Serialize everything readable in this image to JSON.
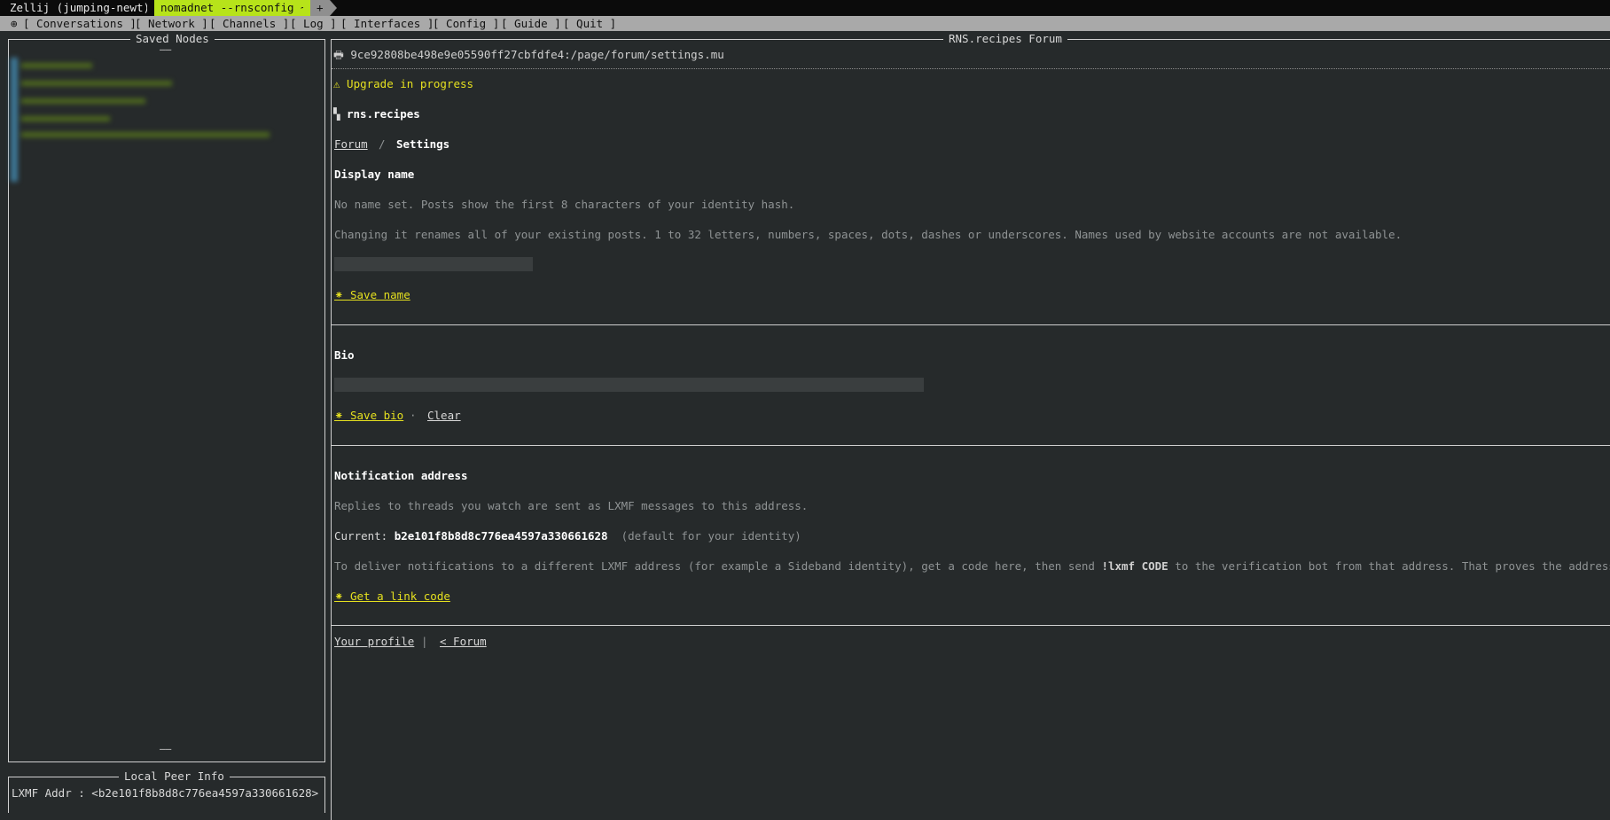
{
  "zellij": {
    "session_label": "Zellij (jumping-newt)",
    "active_tab": "nomadnet --rnsconfig ~",
    "new_tab": "+"
  },
  "menu": {
    "icon": "⊕",
    "items": [
      "[ Conversations ]",
      "[ Network ]",
      "[ Channels ]",
      "[ Log ]",
      "[ Interfaces ]",
      "[ Config ]",
      "[ Guide ]",
      "[ Quit ]"
    ]
  },
  "sidebar": {
    "saved_nodes_title": "Saved Nodes",
    "top_mark": "——",
    "bottom_mark": "——",
    "local_peer_title": "Local Peer Info",
    "lxmf_addr": "LXMF Addr : <b2e101f8b8d8c776ea4597a330661628>"
  },
  "browser": {
    "title": "RNS.recipes Forum",
    "url": "🖶 9ce92808be498e9e05590ff27cbfdfe4:/page/forum/settings.mu",
    "upgrade_notice": "⚠ Upgrade in progress",
    "site_icon": "▚",
    "site_name": "rns.recipes",
    "breadcrumb": {
      "forum": "Forum",
      "sep": "/",
      "current": "Settings"
    },
    "display_name": {
      "heading": "Display name",
      "desc": "No name set. Posts show the first 8 characters of your identity hash.",
      "help": "Changing it renames all of your existing posts. 1 to 32 letters, numbers, spaces, dots, dashes or underscores. Names used by website accounts are not available.",
      "input_value": "",
      "save_label": "⁕ Save name"
    },
    "bio": {
      "heading": "Bio",
      "input_value": "",
      "save_label": "⁕ Save bio",
      "sep": "·",
      "clear_label": "Clear"
    },
    "notification": {
      "heading": "Notification address",
      "desc": "Replies to threads you watch are sent as LXMF messages to this address.",
      "current_label": "Current: ",
      "current_value": "b2e101f8b8d8c776ea4597a330661628",
      "current_note": "(default for your identity)",
      "deliver_pre": "To deliver notifications to a different LXMF address (for example a Sideband identity), get a code here, then send ",
      "deliver_cmd": "!lxmf CODE",
      "deliver_post": " to the verification bot from that address. That proves the address is yours.",
      "link_code_label": "⁕ Get a link code"
    },
    "footer": {
      "profile": "Your profile",
      "sep": "|",
      "back": "< Forum"
    }
  },
  "colors": {
    "accent": "#b7e31a",
    "link_yellow": "#e5e01f",
    "background": "#262a2b"
  }
}
